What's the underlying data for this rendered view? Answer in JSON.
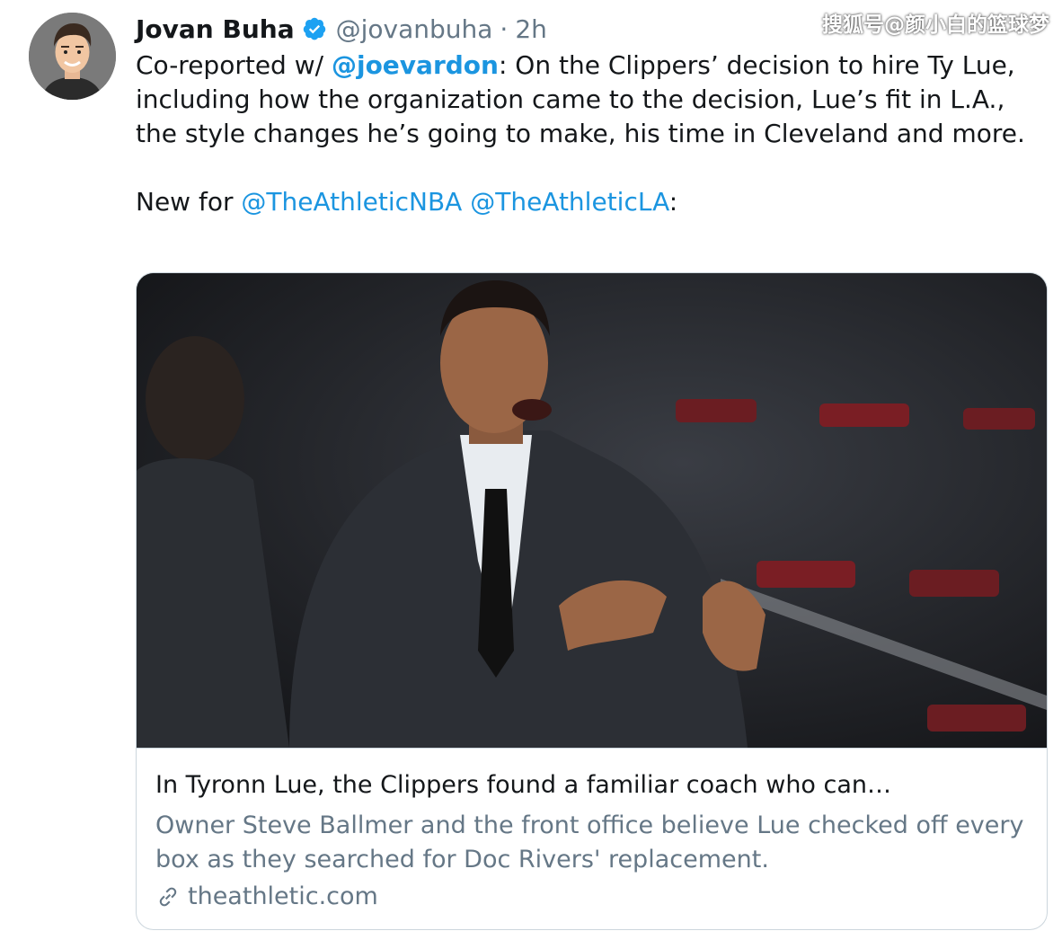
{
  "watermark": "搜狐号@颜小白的篮球梦",
  "tweet": {
    "author": {
      "display_name": "Jovan Buha",
      "handle": "@jovanbuha",
      "separator": "·",
      "time": "2h",
      "avatar_icon": "avatar-illustration",
      "verified_icon": "verified-badge-icon"
    },
    "body": {
      "line1_prefix": "Co-reported w/ ",
      "line1_mention": "@joevardon",
      "line1_rest": ": On the Clippers’ decision to hire Ty Lue, including how the organization came to the decision, Lue’s fit in L.A., the style changes he’s going to make, his time in Cleveland and more.",
      "line2_prefix": "New for ",
      "mention_nba": "@TheAthleticNBA",
      "mention_la": "@TheAthleticLA",
      "line2_suffix": ":"
    },
    "card": {
      "image_label": "Tyronn Lue coaching courtside",
      "title": "In Tyronn Lue, the Clippers found a familiar coach who can…",
      "description": "Owner Steve Ballmer and the front office believe Lue checked off every box as they searched for Doc Rivers' replacement.",
      "domain": "theathletic.com",
      "link_icon": "link-icon"
    }
  },
  "colors": {
    "link": "#1b95e0",
    "muted": "#657786",
    "text": "#14171a",
    "border": "#ccd6dd"
  }
}
